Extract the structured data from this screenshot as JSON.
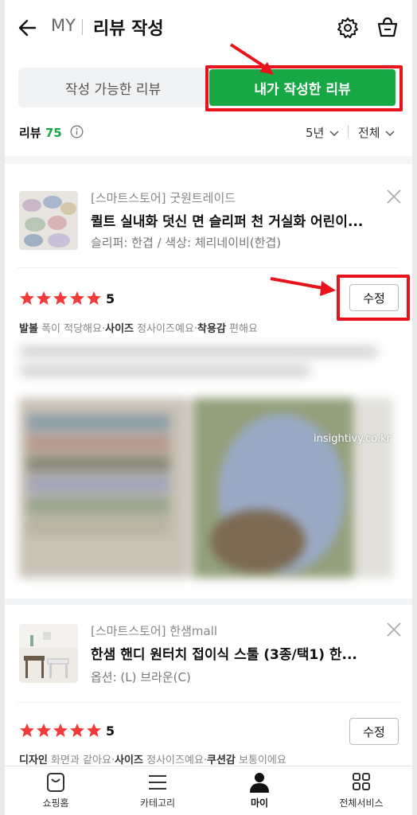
{
  "header": {
    "my": "MY",
    "title": "리뷰 작성"
  },
  "tabs": {
    "available": "작성 가능한 리뷰",
    "mine": "내가 작성한 리뷰"
  },
  "summary": {
    "label": "리뷰",
    "count": "75",
    "period": "5년",
    "scope": "전체"
  },
  "reviews": [
    {
      "store": "[스마트스토어] 굿원트레이드",
      "product": "퀼트 실내화 덧신 면 슬리퍼 천 거실화 어린이...",
      "option": "슬리퍼: 한겹 / 색상: 체리네이비(한겹)",
      "rating": "5",
      "edit_label": "수정",
      "eval": [
        {
          "k": "발볼",
          "v": "폭이 적당해요"
        },
        {
          "k": "사이즈",
          "v": "정사이즈예요"
        },
        {
          "k": "착용감",
          "v": "편해요"
        }
      ]
    },
    {
      "store": "[스마트스토어] 한샘mall",
      "product": "한샘 핸디 원터치 접이식 스툴 (3종/택1) 한...",
      "option": "옵션: (L) 브라운(C)",
      "rating": "5",
      "edit_label": "수정",
      "eval": [
        {
          "k": "디자인",
          "v": "화면과 같아요"
        },
        {
          "k": "사이즈",
          "v": "정사이즈예요"
        },
        {
          "k": "쿠션감",
          "v": "보통이에요"
        }
      ]
    }
  ],
  "watermark": "insightivy.co.kr",
  "nav": [
    {
      "label": "쇼핑홈",
      "icon": "shopping-home-icon"
    },
    {
      "label": "카테고리",
      "icon": "menu-icon"
    },
    {
      "label": "마이",
      "icon": "person-icon"
    },
    {
      "label": "전체서비스",
      "icon": "grid-icon"
    }
  ],
  "colors": {
    "accent": "#17a845",
    "annotation": "#e8131a",
    "star": "#f23a3a"
  }
}
